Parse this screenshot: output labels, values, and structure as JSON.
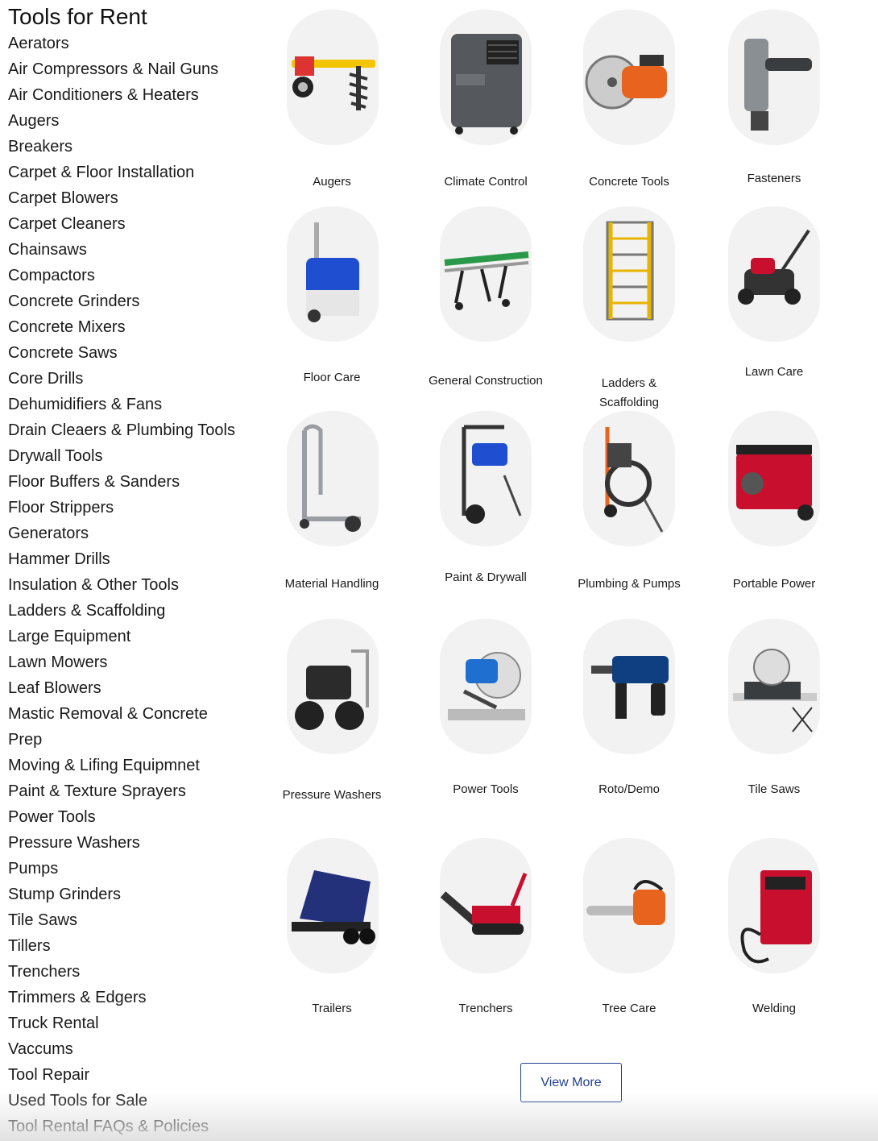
{
  "sidebar": {
    "title": "Tools for Rent",
    "items": [
      "Aerators",
      "Air Compressors & Nail Guns",
      "Air Conditioners & Heaters",
      "Augers",
      "Breakers",
      "Carpet & Floor Installation",
      "Carpet Blowers",
      "Carpet Cleaners",
      "Chainsaws",
      "Compactors",
      "Concrete Grinders",
      "Concrete Mixers",
      "Concrete Saws",
      "Core Drills",
      "Dehumidifiers & Fans",
      "Drain Cleaers & Plumbing Tools",
      "Drywall Tools",
      "Floor Buffers & Sanders",
      "Floor Strippers",
      "Generators",
      "Hammer Drills",
      "Insulation & Other Tools",
      "Ladders & Scaffolding",
      "Large Equipment",
      "Lawn Mowers",
      "Leaf Blowers",
      "Mastic Removal & Concrete",
      "Prep",
      "Moving & Lifing Equipmnet",
      "Paint & Texture Sprayers",
      "Power Tools",
      "Pressure Washers",
      "Pumps",
      "Stump Grinders",
      "Tile Saws",
      "Tillers",
      "Trenchers",
      "Trimmers & Edgers",
      "Truck Rental",
      "Vaccums",
      "Tool Repair",
      "Used Tools for Sale",
      "Tool Rental FAQs & Policies"
    ]
  },
  "categories": [
    {
      "label": "Augers",
      "icon": "auger-icon",
      "color": "#f2c500"
    },
    {
      "label": "Climate Control",
      "icon": "portable-cooler-icon",
      "color": "#55595e"
    },
    {
      "label": "Concrete Tools",
      "icon": "concrete-saw-icon",
      "color": "#e8641e"
    },
    {
      "label": "Fasteners",
      "icon": "nail-gun-icon",
      "color": "#3a3d40"
    },
    {
      "label": "Floor Care",
      "icon": "carpet-cleaner-icon",
      "color": "#1f4fd0"
    },
    {
      "label": "General Construction",
      "icon": "roller-stand-icon",
      "color": "#2a9a4a"
    },
    {
      "label": "Ladders & Scaffolding",
      "icon": "scaffolding-icon",
      "color": "#e7b400"
    },
    {
      "label": "Lawn Care",
      "icon": "lawn-mower-icon",
      "color": "#c8102e"
    },
    {
      "label": "Material Handling",
      "icon": "hand-truck-icon",
      "color": "#9a9ea3"
    },
    {
      "label": "Paint & Drywall",
      "icon": "paint-sprayer-icon",
      "color": "#1f4fd0"
    },
    {
      "label": "Plumbing & Pumps",
      "icon": "drain-machine-icon",
      "color": "#e8641e"
    },
    {
      "label": "Portable Power",
      "icon": "generator-icon",
      "color": "#c8102e"
    },
    {
      "label": "Pressure Washers",
      "icon": "pressure-washer-icon",
      "color": "#2b2b2b"
    },
    {
      "label": "Power Tools",
      "icon": "miter-saw-icon",
      "color": "#1f6fd0"
    },
    {
      "label": "Roto/Demo",
      "icon": "rotary-hammer-icon",
      "color": "#0f3f80"
    },
    {
      "label": "Tile Saws",
      "icon": "tile-saw-icon",
      "color": "#3a3d40"
    },
    {
      "label": "Trailers",
      "icon": "dump-trailer-icon",
      "color": "#23307a"
    },
    {
      "label": "Trenchers",
      "icon": "trencher-icon",
      "color": "#c8102e"
    },
    {
      "label": "Tree Care",
      "icon": "chainsaw-icon",
      "color": "#e8641e"
    },
    {
      "label": "Welding",
      "icon": "welder-icon",
      "color": "#c8102e"
    }
  ],
  "view_more_label": "View More",
  "colors": {
    "accent": "#1f3f8f",
    "thumb_bg": "#f2f2f2",
    "text": "#1a1a1a"
  }
}
